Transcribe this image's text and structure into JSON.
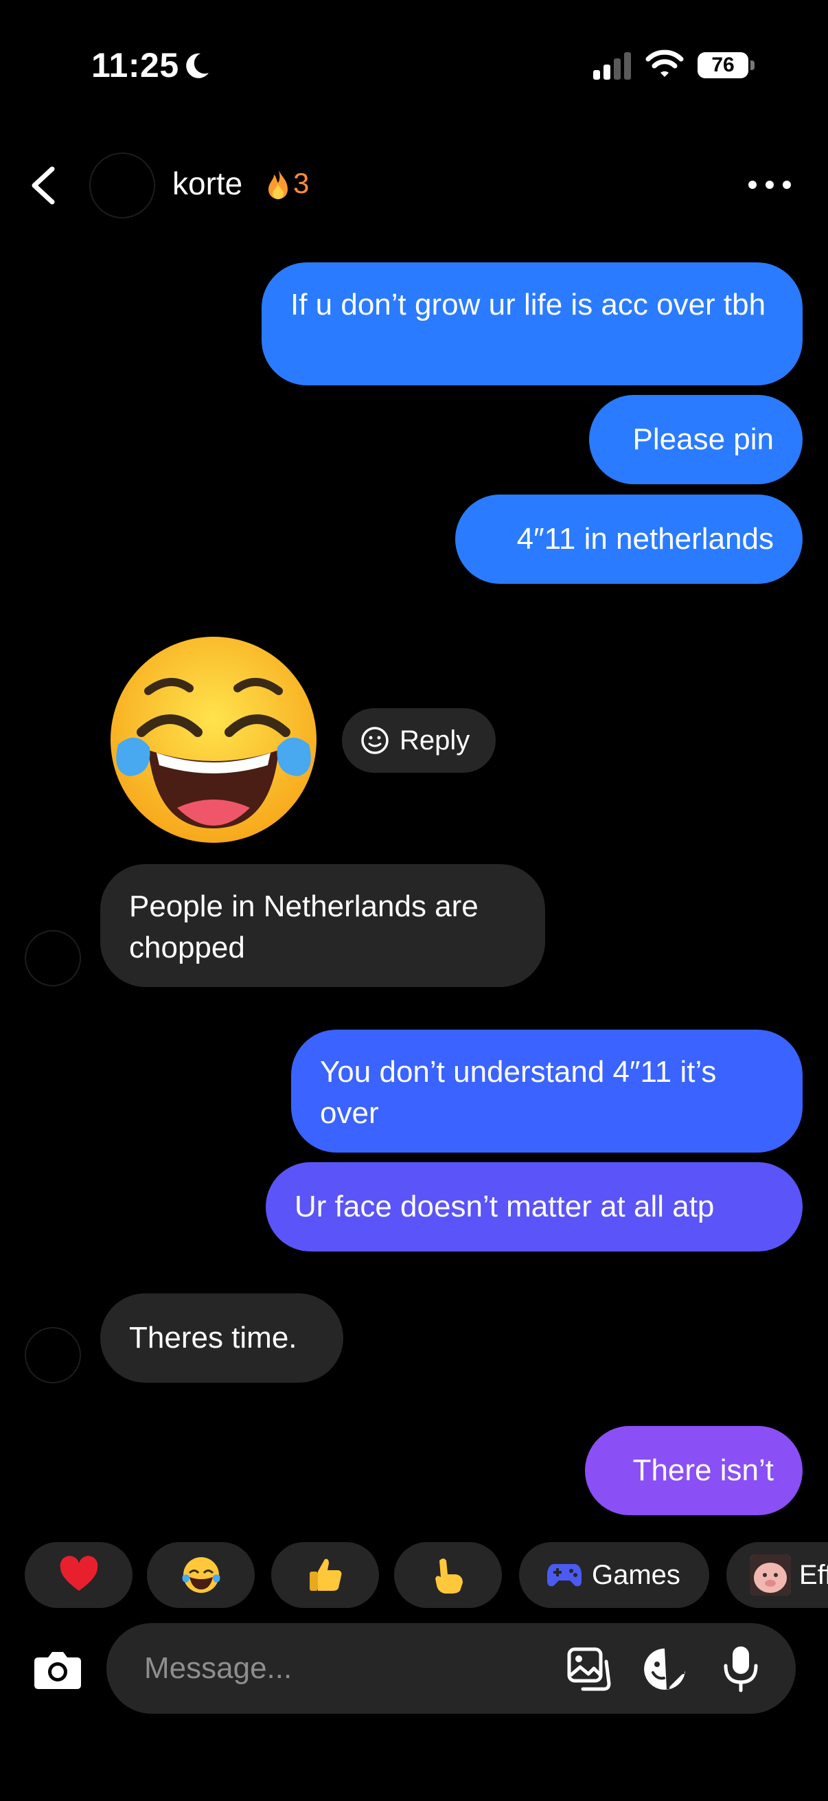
{
  "status_bar": {
    "time": "11:25",
    "battery": "76",
    "icons": [
      "moon-icon",
      "signal-icon",
      "wifi-icon",
      "battery-icon"
    ]
  },
  "header": {
    "name": "korte",
    "streak_count": "3",
    "streak_color": "#ff8a3d",
    "icons": [
      "back-chevron-icon",
      "fire-icon",
      "more-options-icon"
    ]
  },
  "messages": [
    {
      "from": "me",
      "text": "If u don’t grow ur life is acc over tbh"
    },
    {
      "from": "me",
      "text": "Please pin"
    },
    {
      "from": "me",
      "text": "4″11 in netherlands"
    },
    {
      "from": "them",
      "emoji": "face-with-tears-of-joy"
    },
    {
      "from": "them",
      "text": "People in Netherlands are chopped"
    },
    {
      "from": "me",
      "text": "You don’t understand 4″11 it’s over"
    },
    {
      "from": "me",
      "text": "Ur face doesn’t matter at all atp"
    },
    {
      "from": "them",
      "text": "Theres time."
    },
    {
      "from": "me",
      "text": "There isn’t"
    }
  ],
  "reply_chip": {
    "label": "Reply",
    "icon": "smiley-reply-icon"
  },
  "quick_reactions": [
    {
      "icon": "red-heart-icon"
    },
    {
      "icon": "tears-of-joy-icon"
    },
    {
      "icon": "thumbs-up-icon"
    },
    {
      "icon": "pointing-hand-icon"
    },
    {
      "icon": "gamepad-icon",
      "label": "Games"
    },
    {
      "icon": "effects-thumbnail",
      "label": "Eff"
    }
  ],
  "composer": {
    "placeholder": "Message...",
    "icons": [
      "camera-icon",
      "gallery-icon",
      "sticker-icon",
      "microphone-icon"
    ]
  },
  "colors": {
    "background": "#000000",
    "incoming_bubble": "#262626",
    "outgoing_gradient": [
      "#2a7bff",
      "#3a63ff",
      "#5b54f9",
      "#8a4ff5"
    ]
  }
}
